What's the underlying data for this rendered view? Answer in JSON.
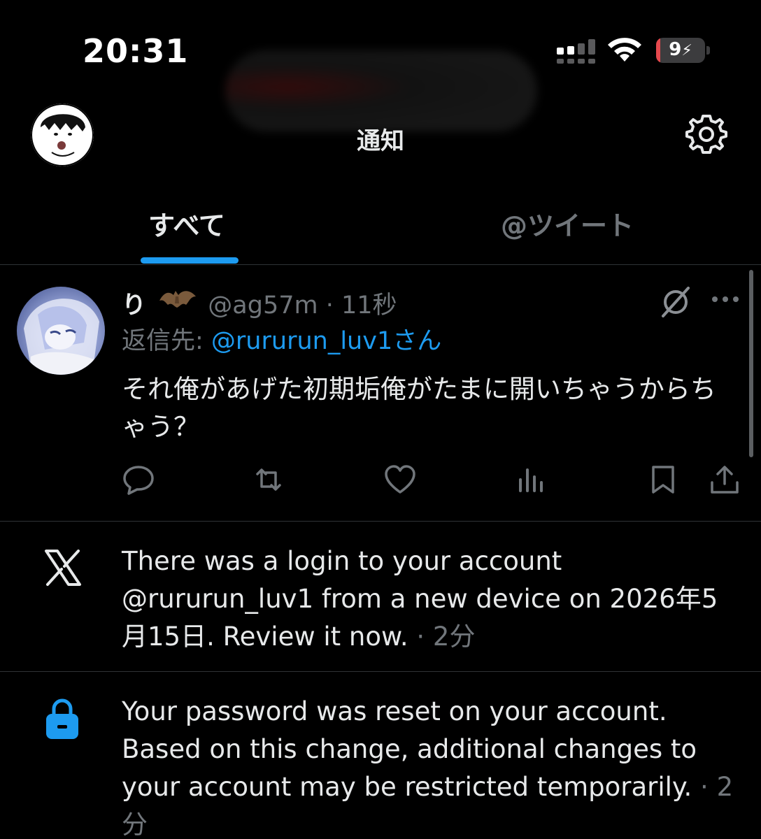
{
  "status_bar": {
    "time": "20:31",
    "battery_level": "9",
    "battery_fraction": 0.09,
    "battery_color": "#e5484d",
    "icons": [
      "signal-icon",
      "wifi-icon",
      "battery-icon"
    ]
  },
  "header": {
    "title": "通知",
    "settings_icon": "gear-icon"
  },
  "tabs": [
    {
      "label": "すべて",
      "active": true
    },
    {
      "label": "@ツイート",
      "active": false
    }
  ],
  "tweet": {
    "display_name": "り",
    "name_emoji": "bat-icon",
    "handle": "@ag57m",
    "separator": "·",
    "time": "11秒",
    "reply_prefix": "返信先: ",
    "reply_handle": "@rururun_luv1さん",
    "text": "それ俺があげた初期垢俺がたまに開いちゃうからちゃう？",
    "actions": [
      "reply-icon",
      "retweet-icon",
      "like-icon",
      "views-icon",
      "bookmark-icon",
      "share-icon"
    ]
  },
  "notifications": [
    {
      "icon": "x-logo-icon",
      "text": "There was a login to your account @rururun_luv1 from a new device on 2026年5月15日. Review it now.",
      "time": " · 2分"
    },
    {
      "icon": "lock-icon",
      "text": "Your password was reset on your account. Based on this change, additional changes to your account may be restricted temporarily.",
      "time": " · 2分"
    }
  ],
  "colors": {
    "accent": "#1d9bf0",
    "background": "#000000",
    "text_primary": "#e7e9ea",
    "text_secondary": "#71767b",
    "divider": "#2f3336"
  }
}
